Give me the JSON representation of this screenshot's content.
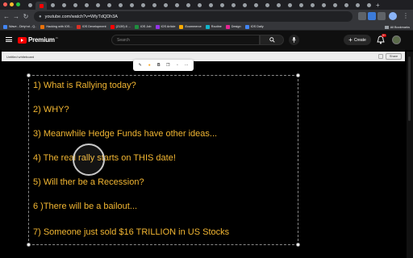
{
  "browser": {
    "url": "youtube.com/watch?v=WfyTdQDh3A",
    "bookmarks": [
      {
        "label": "Wave - Dirty'rot - Q..",
        "color": "#4285f4"
      },
      {
        "label": "Hacking with IOS...",
        "color": "#e8710a"
      },
      {
        "label": "IOS Development",
        "color": "#d93025"
      },
      {
        "label": "(2139) 8 ...",
        "color": "#ff0000"
      },
      {
        "label": "iOS Job",
        "color": "#1e8e3e"
      },
      {
        "label": "IOS Article",
        "color": "#9334e6"
      },
      {
        "label": "Ecommerce",
        "color": "#f9ab00"
      },
      {
        "label": "Routine",
        "color": "#12b5cb"
      },
      {
        "label": "Design",
        "color": "#e52592"
      },
      {
        "label": "IOS Daily",
        "color": "#4285f4"
      }
    ],
    "all_bookmarks": "All Bookmarks"
  },
  "youtube": {
    "logo": "Premium",
    "country": "IN",
    "search_placeholder": "Search",
    "create_label": "Create",
    "notifications": "9+"
  },
  "whiteboard": {
    "title": "Untitled whiteboard",
    "share_label": "Share",
    "lines": [
      "1) What is Rallying today?",
      "2) WHY?",
      "3) Meanwhile Hedge Funds have other ideas...",
      "4) The real rally starts on THIS date!",
      "5) Will ther be a Recession?",
      "6 )There will be a bailout...",
      "7) Someone just sold $16 TRILLION in US Stocks"
    ]
  },
  "colors": {
    "text_accent": "#f2b632",
    "youtube_red": "#ff0000"
  }
}
